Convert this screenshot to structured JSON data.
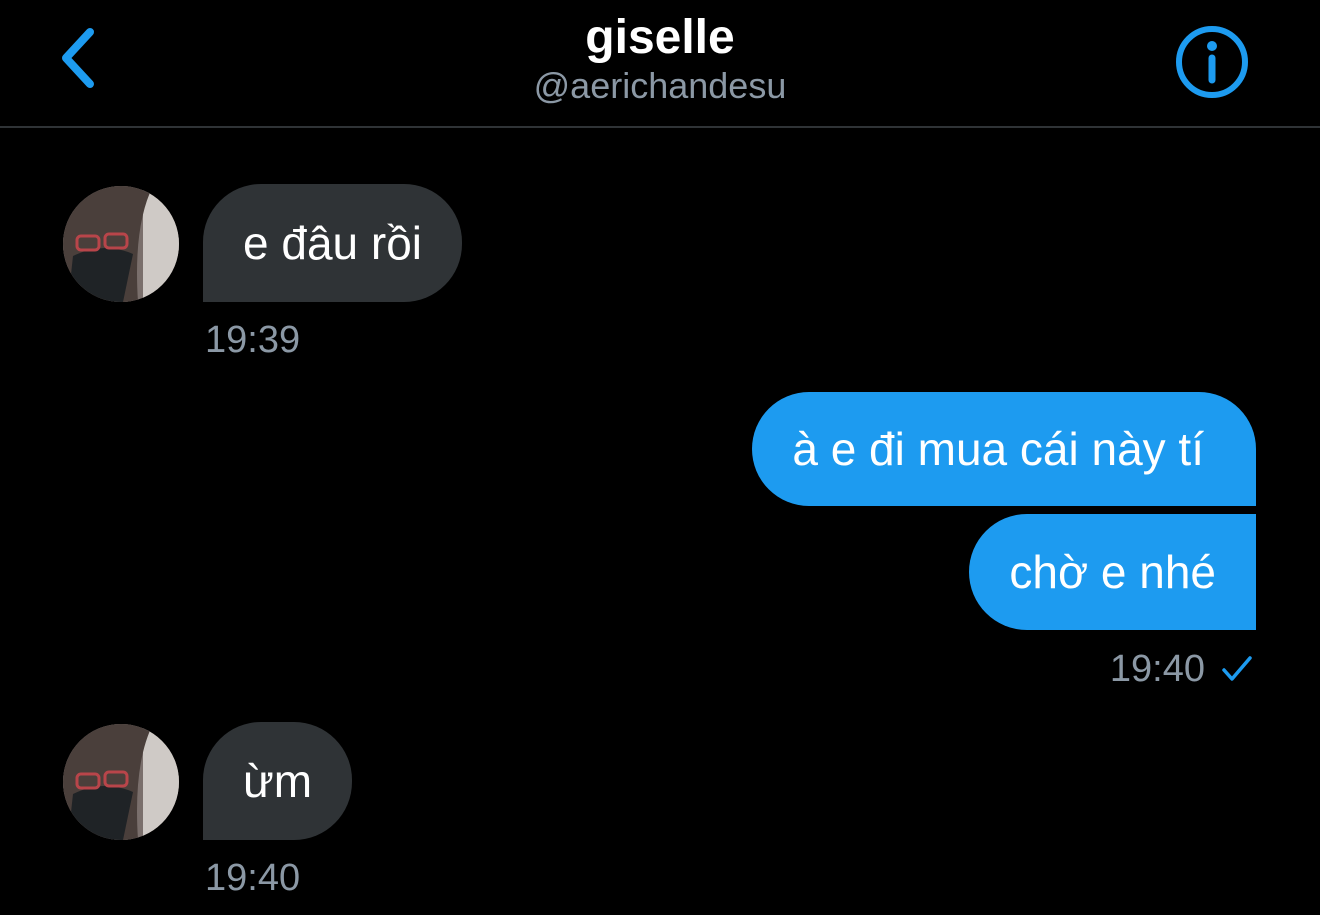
{
  "header": {
    "back_icon": "chevron-left-icon",
    "title": "giselle",
    "handle": "@aerichandesu",
    "info_icon": "info-icon"
  },
  "colors": {
    "background": "#000000",
    "accent": "#1d9bf0",
    "incoming_bubble": "#2f3336",
    "muted_text": "#8b98a5"
  },
  "messages": [
    {
      "direction": "incoming",
      "text": "e đâu rồi"
    },
    {
      "direction": "incoming",
      "time": "19:39"
    },
    {
      "direction": "outgoing",
      "text": "à e đi mua cái này tí"
    },
    {
      "direction": "outgoing",
      "text": "chờ e nhé"
    },
    {
      "direction": "outgoing",
      "time": "19:40",
      "status_icon": "checkmark-icon"
    },
    {
      "direction": "incoming",
      "text": "ừm"
    },
    {
      "direction": "incoming",
      "time": "19:40"
    }
  ]
}
